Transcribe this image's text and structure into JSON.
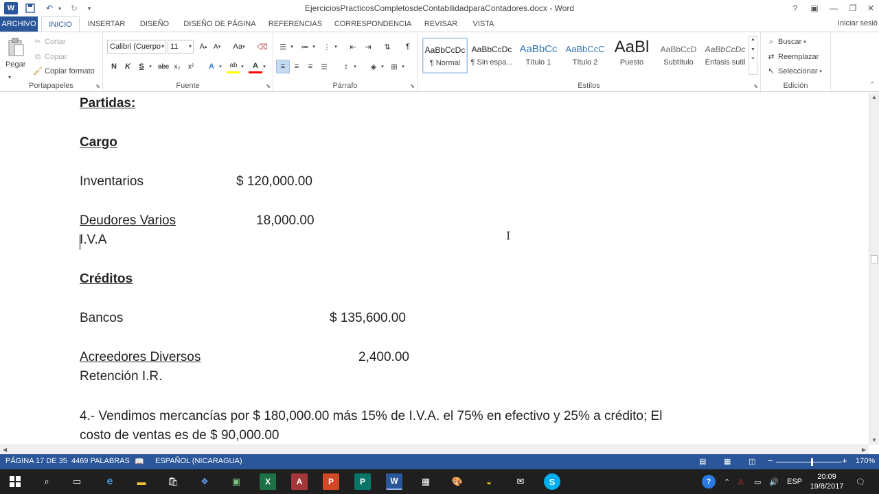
{
  "window": {
    "title": "EjerciciosPracticosCompletosdeContabilidadparaContadores.docx - Word",
    "app_icon": "W",
    "help": "?",
    "colors": {
      "brand": "#2b579a",
      "taskbar": "#1f1f1f"
    }
  },
  "tabs": {
    "archivo": "ARCHIVO",
    "items": [
      "INICIO",
      "INSERTAR",
      "DISEÑO",
      "DISEÑO DE PÁGINA",
      "REFERENCIAS",
      "CORRESPONDENCIA",
      "REVISAR",
      "VISTA"
    ],
    "signin": "Iniciar sesió"
  },
  "ribbon": {
    "clipboard": {
      "label": "Portapapeles",
      "paste": "Pegar",
      "cut": "Cortar",
      "copy": "Copiar",
      "format_painter": "Copiar formato"
    },
    "font": {
      "label": "Fuente",
      "font_name": "Calibri (Cuerpo",
      "font_size": "11",
      "grow": "A",
      "shrink": "A",
      "case": "Aa",
      "bold": "N",
      "italic": "K",
      "underline": "S",
      "strike": "abc",
      "subscript": "x₂",
      "superscript": "x²",
      "text_effects": "A",
      "highlight": "ab",
      "font_color": "A"
    },
    "paragraph": {
      "label": "Párrafo",
      "pilcrow": "¶"
    },
    "styles": {
      "label": "Estilos",
      "items": [
        {
          "preview": "AaBbCcDc",
          "name": "¶ Normal"
        },
        {
          "preview": "AaBbCcDc",
          "name": "¶ Sin espa..."
        },
        {
          "preview": "AaBbCc",
          "name": "Título 1"
        },
        {
          "preview": "AaBbCcC",
          "name": "Título 2"
        },
        {
          "preview": "AaBl",
          "name": "Puesto"
        },
        {
          "preview": "AaBbCcD",
          "name": "Subtítulo"
        },
        {
          "preview": "AaBbCcDc",
          "name": "Énfasis sutil"
        }
      ]
    },
    "editing": {
      "label": "Edición",
      "find": "Buscar",
      "replace": "Reemplazar",
      "select": "Seleccionar"
    }
  },
  "document": {
    "heading": "Partidas:",
    "cargo": "Cargo",
    "inventarios": "Inventarios",
    "inventarios_amount": "$ 120,000.00",
    "deudores": "Deudores Varios",
    "deudores_amount": "18,000.00",
    "iva": "I.V.A",
    "creditos": "Créditos",
    "bancos": "Bancos",
    "bancos_amount": "$ 135,600.00",
    "acreedores": "Acreedores Diversos",
    "acreedores_amount": "2,400.00",
    "retencion": "Retención I.R.",
    "para_line1": "4.- Vendimos mercancías por $ 180,000.00 más 15% de I.V.A. el 75% en efectivo y 25% a crédito; El",
    "para_line2": "costo de ventas es de $ 90,000.00"
  },
  "statusbar": {
    "page": "PÁGINA 17 DE 35",
    "words": "4469 PALABRAS",
    "language": "ESPAÑOL (NICARAGUA)",
    "zoom": "170%",
    "zoom_minus": "−",
    "zoom_plus": "+"
  },
  "taskbar": {
    "apps": [
      "X",
      "A",
      "P",
      "P",
      "W"
    ],
    "lang": "ESP",
    "time": "20:09",
    "date": "19/8/2017"
  }
}
